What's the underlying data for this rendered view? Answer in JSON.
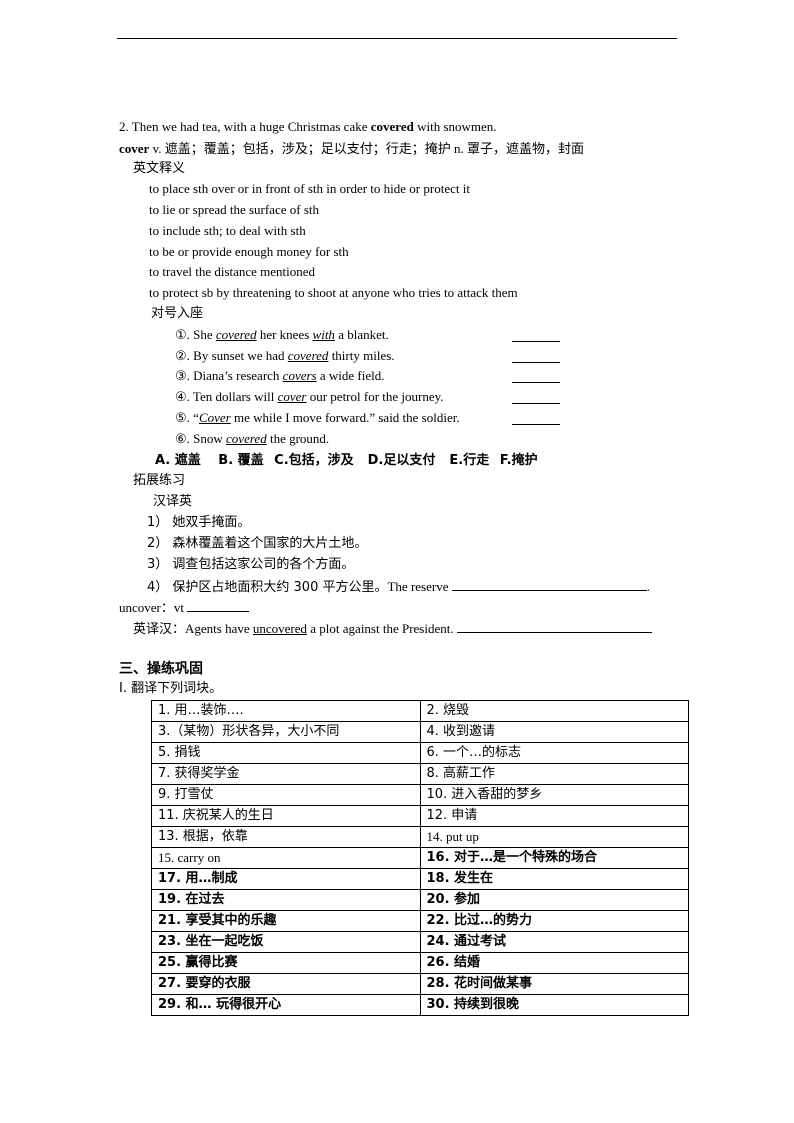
{
  "item2": {
    "sentence_pre": "2. Then we had tea, with a huge Christmas cake ",
    "sentence_bold": "covered",
    "sentence_post": " with snowmen.",
    "word": "cover",
    "word_pos": " v. ",
    "word_meanings_v": "遮盖；覆盖；包括，涉及；足以支付；行走；掩护",
    "word_pos_n": " n. ",
    "word_meanings_n": "罩子，遮盖物，封面"
  },
  "english_definitions": {
    "heading": "英文释义",
    "items": [
      "to place sth over or in front of sth in order to hide or protect it",
      "to lie or spread the surface of sth",
      "to include sth; to deal with sth",
      "to be or provide enough money for sth",
      "to travel the distance mentioned",
      "to protect sb by threatening to shoot at anyone who tries to attack them"
    ]
  },
  "matching": {
    "heading": "对号入座",
    "items": [
      {
        "num": "①. ",
        "pre": "She ",
        "key": "covered",
        "mid": " her knees ",
        "key2": "with",
        "post": " a blanket."
      },
      {
        "num": "②. ",
        "pre": "By sunset we had ",
        "key": "covered",
        "mid": " thirty miles.",
        "key2": "",
        "post": ""
      },
      {
        "num": "③. ",
        "pre": "Diana’s research ",
        "key": "covers",
        "mid": " a wide field.",
        "key2": "",
        "post": ""
      },
      {
        "num": "④. ",
        "pre": "Ten dollars will ",
        "key": "cover",
        "mid": " our petrol for the journey.",
        "key2": "",
        "post": ""
      },
      {
        "num": "⑤. ",
        "pre": "“",
        "key": "Cover",
        "mid": " me while I move forward.” said the soldier.",
        "key2": "",
        "post": ""
      },
      {
        "num": "⑥. ",
        "pre": "Snow ",
        "key": "covered",
        "mid": " the ground.",
        "key2": "",
        "post": ""
      }
    ],
    "options": [
      "A. 遮盖",
      "B. 覆盖",
      "C.包括，涉及",
      "D.足以支付",
      "E.行走",
      "F.掩护"
    ]
  },
  "extension": {
    "heading": "拓展练习",
    "subheading": "汉译英",
    "items": [
      "1） 她双手掩面。",
      "2） 森林覆盖着这个国家的大片土地。",
      "3） 调查包括这家公司的各个方面。",
      "4） 保护区占地面积大约 300 平方公里。"
    ],
    "item4_en": "The reserve ",
    "item4_end": "."
  },
  "uncover": {
    "label": "uncover：vt ",
    "translate_label": "英译汉：",
    "sentence_pre": "Agents have ",
    "sentence_key": "uncovered",
    "sentence_post": " a plot against the President. "
  },
  "section3": {
    "title": "三、操练巩固",
    "part1": "I.  翻译下列词块。",
    "rows": [
      [
        "1.  用…装饰….",
        "2.  烧毁"
      ],
      [
        "3.（某物）形状各异，大小不同",
        "4.  收到邀请"
      ],
      [
        "5.  捐钱",
        "6.  一个…的标志"
      ],
      [
        "7.  获得奖学金",
        "8.  高薪工作"
      ],
      [
        "9.  打雪仗",
        "10.  进入香甜的梦乡"
      ],
      [
        "11.  庆祝某人的生日",
        "12.  申请"
      ],
      [
        "13.  根据，依靠",
        "14. put up"
      ],
      [
        "15. carry on",
        "16.  对于…是一个特殊的场合"
      ],
      [
        "17.  用…制成",
        "18.  发生在"
      ],
      [
        "19.  在过去",
        "20.  参加"
      ],
      [
        "21.  享受其中的乐趣",
        "22.  比过…的势力"
      ],
      [
        "23.  坐在一起吃饭",
        "24.  通过考试"
      ],
      [
        "25.  赢得比赛",
        "26.  结婚"
      ],
      [
        "27.  要穿的衣服",
        "28.  花时间做某事"
      ],
      [
        "29.  和…  玩得很开心",
        "30.  持续到很晚"
      ]
    ]
  }
}
